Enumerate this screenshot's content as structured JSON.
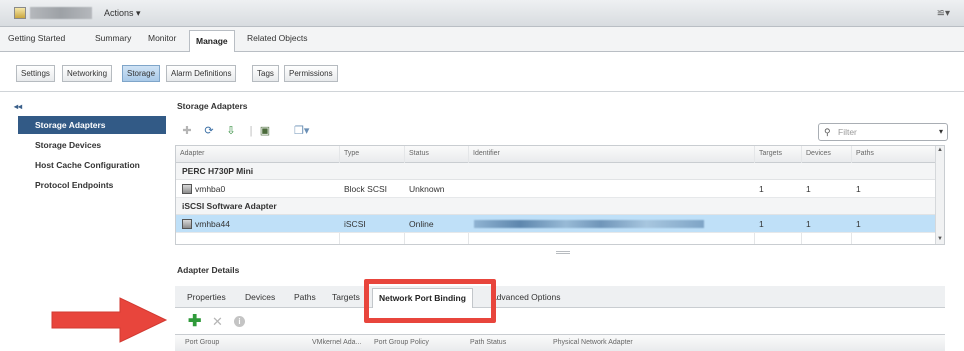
{
  "header": {
    "actions_label": "Actions ▾",
    "topright_icon": "≌▾"
  },
  "nav_tabs": [
    "Getting Started",
    "Summary",
    "Monitor",
    "Manage",
    "Related Objects"
  ],
  "active_nav_tab": "Manage",
  "sub_tabs": [
    "Settings",
    "Networking",
    "Storage",
    "Alarm Definitions",
    "Tags",
    "Permissions"
  ],
  "active_sub_tab": "Storage",
  "sidebar": {
    "collapse_label": "◂◂",
    "items": [
      "Storage Adapters",
      "Storage Devices",
      "Host Cache Configuration",
      "Protocol Endpoints"
    ],
    "active": "Storage Adapters"
  },
  "storage_adapters": {
    "title": "Storage Adapters",
    "filter_placeholder": "Filter",
    "columns": [
      "Adapter",
      "Type",
      "Status",
      "Identifier",
      "Targets",
      "Devices",
      "Paths"
    ],
    "groups": [
      {
        "name": "PERC H730P Mini",
        "rows": [
          {
            "adapter": "vmhba0",
            "type": "Block SCSI",
            "status": "Unknown",
            "identifier": "",
            "targets": "1",
            "devices": "1",
            "paths": "1",
            "selected": false
          }
        ]
      },
      {
        "name": "iSCSI Software Adapter",
        "rows": [
          {
            "adapter": "vmhba44",
            "type": "iSCSI",
            "status": "Online",
            "identifier": "",
            "targets": "1",
            "devices": "1",
            "paths": "1",
            "selected": true
          }
        ]
      }
    ]
  },
  "adapter_details": {
    "title": "Adapter Details",
    "tabs": [
      "Properties",
      "Devices",
      "Paths",
      "Targets",
      "Network Port Binding",
      "Advanced Options"
    ],
    "active_tab": "Network Port Binding",
    "columns": [
      "Port Group",
      "VMkernel Ada...",
      "Port Group Policy",
      "Path Status",
      "Physical Network Adapter"
    ]
  },
  "colors": {
    "highlight": "#e8453c",
    "selected_row": "#bfe0f8",
    "sidebar_active": "#325a86",
    "add_green": "#2f9a3a"
  }
}
